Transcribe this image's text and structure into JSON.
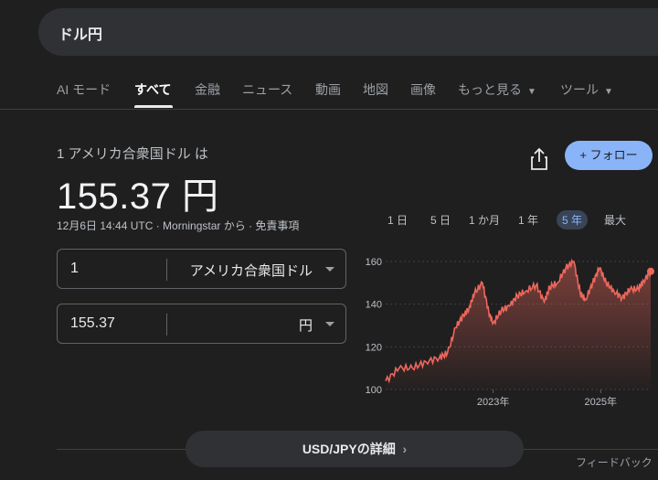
{
  "search": {
    "query": "ドル円"
  },
  "tabs": [
    {
      "label": "AI モード"
    },
    {
      "label": "すべて"
    },
    {
      "label": "金融"
    },
    {
      "label": "ニュース"
    },
    {
      "label": "動画"
    },
    {
      "label": "地図"
    },
    {
      "label": "画像"
    },
    {
      "label": "もっと見る"
    },
    {
      "label": "ツール"
    }
  ],
  "converter": {
    "from_label": "1 アメリカ合衆国ドル は",
    "rate": "155.37 円",
    "meta": "12月6日 14:44 UTC · Morningstar から · 免責事項",
    "from_value": "1",
    "from_unit": "アメリカ合衆国ドル",
    "to_value": "155.37",
    "to_unit": "円"
  },
  "actions": {
    "follow": "+ フォロー"
  },
  "ranges": [
    "1 日",
    "5 日",
    "1 か月",
    "1 年",
    "5 年",
    "最大"
  ],
  "footer": {
    "details": "USD/JPYの詳細",
    "feedback": "フィードバック"
  },
  "colors": {
    "accent": "#8ab4f8",
    "line": "#ee675c"
  },
  "chart_data": {
    "type": "area",
    "title": "",
    "xlabel": "",
    "ylabel": "",
    "ylim": [
      100,
      160
    ],
    "yticks": [
      100,
      120,
      140,
      160
    ],
    "xticks": [
      "2023年",
      "2025年"
    ],
    "x": [
      2021.0,
      2021.25,
      2021.5,
      2021.75,
      2022.0,
      2022.15,
      2022.3,
      2022.45,
      2022.55,
      2022.65,
      2022.8,
      2022.92,
      2023.0,
      2023.15,
      2023.3,
      2023.45,
      2023.6,
      2023.8,
      2023.95,
      2024.05,
      2024.2,
      2024.35,
      2024.5,
      2024.62,
      2024.72,
      2024.85,
      2024.98,
      2025.1,
      2025.25,
      2025.4,
      2025.55,
      2025.7,
      2025.8,
      2025.93
    ],
    "values": [
      104,
      110,
      110,
      113,
      115,
      117,
      129,
      135,
      138,
      145,
      150,
      136,
      131,
      137,
      139,
      144,
      146,
      149,
      141,
      148,
      150,
      157,
      160,
      145,
      142,
      150,
      157,
      150,
      146,
      143,
      147,
      147,
      151,
      155.37
    ]
  }
}
